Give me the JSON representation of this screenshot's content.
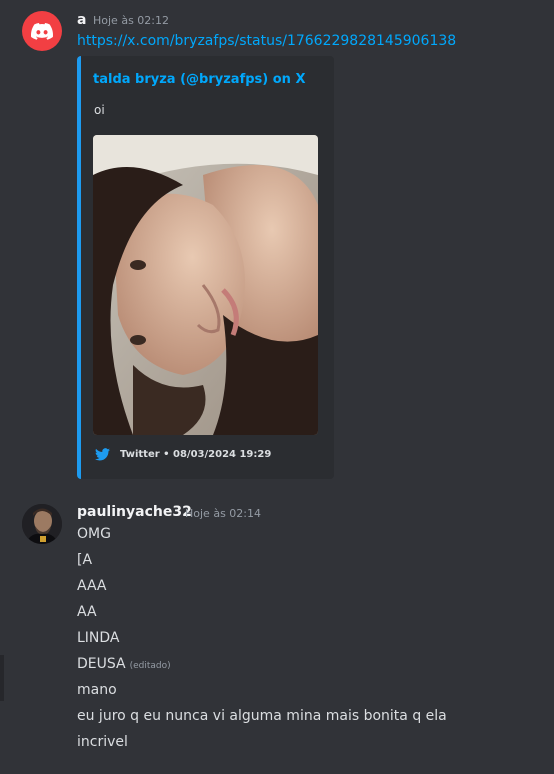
{
  "colors": {
    "background": "#313338",
    "link": "#00a8fc",
    "twitter": "#1d9bf0",
    "discord_avatar": "#f23f43"
  },
  "messages": [
    {
      "author": "a",
      "timestamp": "Hoje às 02:12",
      "avatar_icon": "discord-logo-icon",
      "link": "https://x.com/bryzafps/status/1766229828145906138",
      "embed": {
        "author": "talda bryza (@bryzafps) on X",
        "description": "oi",
        "footer": "Twitter • 08/03/2024 19:29",
        "footer_icon": "twitter-bird-icon"
      }
    },
    {
      "author": "paulinyache32",
      "timestamp": "Hoje às 02:14",
      "lines": [
        "OMG",
        "[A",
        "AAA",
        "AA",
        "LINDA",
        "DEUSA",
        "mano",
        "eu juro q eu nunca vi alguma mina mais bonita q ela",
        "incrivel"
      ],
      "edited_label": "(editado)"
    }
  ]
}
